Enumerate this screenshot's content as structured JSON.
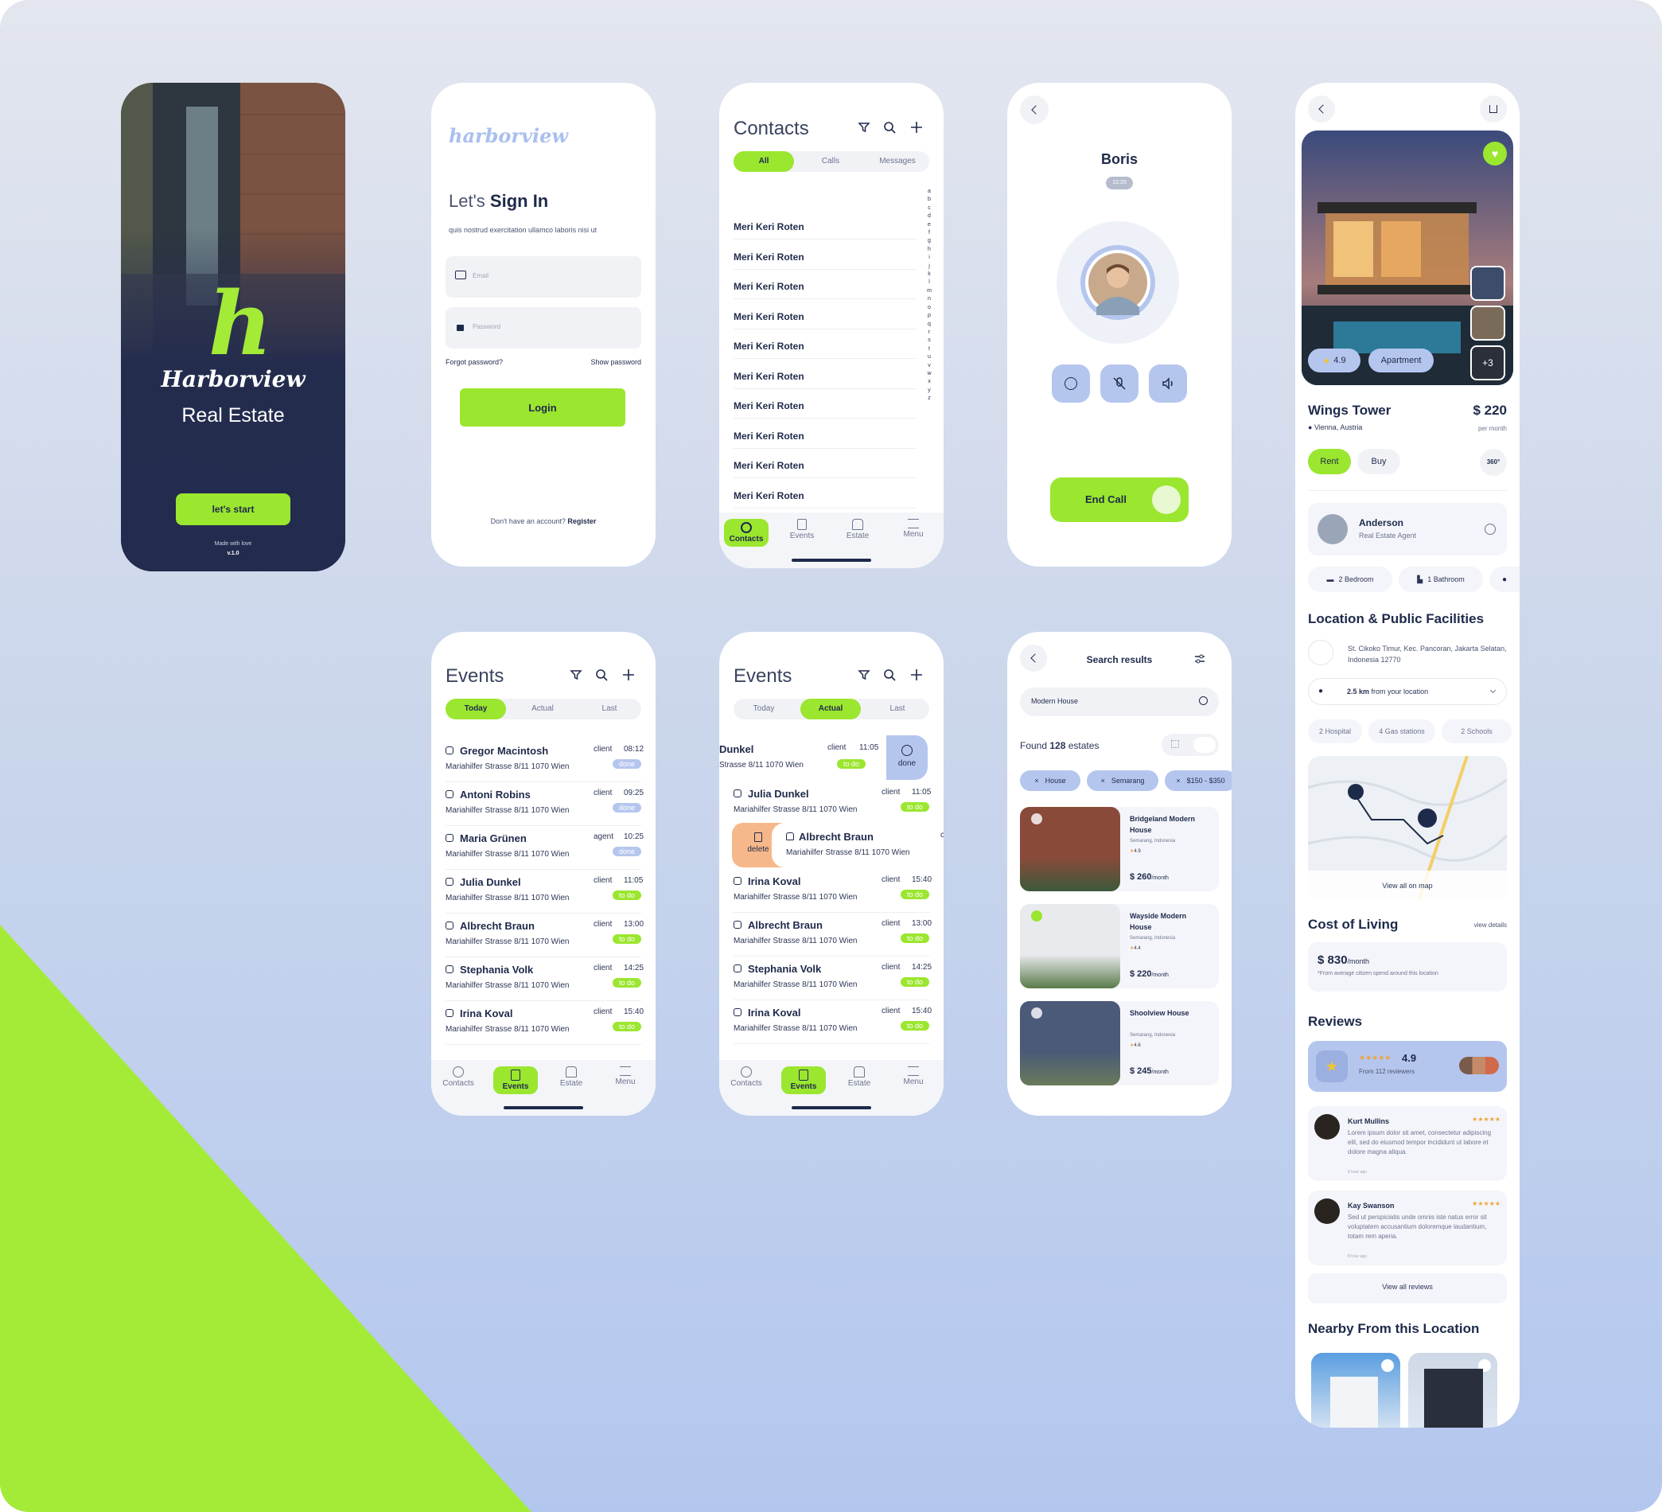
{
  "splash": {
    "brand": "Harborview",
    "subtitle": "Real Estate",
    "cta": "let's start",
    "made": "Made with love",
    "version": "v.1.0"
  },
  "signin": {
    "logo": "harborview",
    "title_light": "Let's",
    "title_bold": "Sign In",
    "subtitle": "quis nostrud exercitation ullamco laboris nisi ut",
    "email_ph": "Email",
    "password_ph": "Password",
    "forgot": "Forgot password?",
    "show": "Show password",
    "login": "Login",
    "no_account": "Don't have an account?",
    "register": "Register"
  },
  "contacts": {
    "title": "Contacts",
    "tabs": [
      "All",
      "Calls",
      "Messages"
    ],
    "items": [
      "Meri Keri Roten",
      "Meri Keri Roten",
      "Meri Keri Roten",
      "Meri Keri Roten",
      "Meri Keri Roten",
      "Meri Keri Roten",
      "Meri Keri Roten",
      "Meri Keri Roten",
      "Meri Keri Roten",
      "Meri Keri Roten",
      "Meri Keri Roten"
    ],
    "alphabet": [
      "a",
      "b",
      "c",
      "d",
      "e",
      "f",
      "g",
      "h",
      "i",
      "j",
      "k",
      "l",
      "m",
      "n",
      "o",
      "p",
      "q",
      "r",
      "s",
      "t",
      "u",
      "v",
      "w",
      "x",
      "y",
      "z"
    ]
  },
  "nav": {
    "contacts": "Contacts",
    "events": "Events",
    "estate": "Estate",
    "menu": "Menu"
  },
  "call": {
    "name": "Boris",
    "duration": "12:25",
    "end": "End Call"
  },
  "events1": {
    "title": "Events",
    "tabs": [
      "Today",
      "Actual",
      "Last"
    ],
    "items": [
      {
        "name": "Gregor Macintosh",
        "role": "client",
        "time": "08:12",
        "addr": "Mariahilfer Strasse 8/11 1070 Wien",
        "status": "done"
      },
      {
        "name": "Antoni Robins",
        "role": "client",
        "time": "09:25",
        "addr": "Mariahilfer Strasse 8/11 1070 Wien",
        "status": "done"
      },
      {
        "name": "Maria Grünen",
        "role": "agent",
        "time": "10:25",
        "addr": "Mariahilfer Strasse 8/11 1070 Wien",
        "status": "done"
      },
      {
        "name": "Julia Dunkel",
        "role": "client",
        "time": "11:05",
        "addr": "Mariahilfer Strasse 8/11 1070 Wien",
        "status": "to do"
      },
      {
        "name": "Albrecht Braun",
        "role": "client",
        "time": "13:00",
        "addr": "Mariahilfer Strasse 8/11 1070 Wien",
        "status": "to do"
      },
      {
        "name": "Stephania Volk",
        "role": "client",
        "time": "14:25",
        "addr": "Mariahilfer Strasse 8/11 1070 Wien",
        "status": "to do"
      },
      {
        "name": "Irina Koval",
        "role": "client",
        "time": "15:40",
        "addr": "Mariahilfer Strasse 8/11 1070 Wien",
        "status": "to do"
      }
    ]
  },
  "events2": {
    "title": "Events",
    "tabs": [
      "Today",
      "Actual",
      "Last"
    ],
    "swiped_right": {
      "name": "Dunkel",
      "role": "client",
      "time": "11:05",
      "addr": "Strasse 8/11 1070 Wien",
      "status": "to do",
      "action": "done"
    },
    "swiped_left": {
      "name": "Albrecht Braun",
      "addr": "Mariahilfer Strasse 8/11 1070 Wien",
      "action": "delete",
      "role": "cl"
    },
    "items": [
      {
        "name": "Julia Dunkel",
        "role": "client",
        "time": "11:05",
        "addr": "Mariahilfer Strasse 8/11 1070 Wien",
        "status": "to do"
      },
      {
        "name": "Irina Koval",
        "role": "client",
        "time": "15:40",
        "addr": "Mariahilfer Strasse 8/11 1070 Wien",
        "status": "to do"
      },
      {
        "name": "Albrecht Braun",
        "role": "client",
        "time": "13:00",
        "addr": "Mariahilfer Strasse 8/11 1070 Wien",
        "status": "to do"
      },
      {
        "name": "Stephania Volk",
        "role": "client",
        "time": "14:25",
        "addr": "Mariahilfer Strasse 8/11 1070 Wien",
        "status": "to do"
      },
      {
        "name": "Irina Koval",
        "role": "client",
        "time": "15:40",
        "addr": "Mariahilfer Strasse 8/11 1070 Wien",
        "status": "to do"
      }
    ]
  },
  "search": {
    "title": "Search results",
    "query": "Modern House",
    "found_pre": "Found",
    "found_count": "128",
    "found_post": "estates",
    "chips": [
      "House",
      "Semarang",
      "$150 - $350"
    ],
    "results": [
      {
        "name": "Bridgeland Modern House",
        "loc": "Semarang, Indonesia",
        "rating": "4.9",
        "price": "$ 260",
        "per": "/month"
      },
      {
        "name": "Wayside Modern House",
        "loc": "Semarang, Indonesia",
        "rating": "4.4",
        "price": "$ 220",
        "per": "/month"
      },
      {
        "name": "Shoolview House",
        "loc": "Semarang, Indonesia",
        "rating": "4.6",
        "price": "$ 245",
        "per": "/month"
      }
    ]
  },
  "detail": {
    "rating": "4.9",
    "type": "Apartment",
    "more": "+3",
    "name": "Wings Tower",
    "location": "Vienna, Austria",
    "price": "$ 220",
    "per": "per month",
    "rent": "Rent",
    "buy": "Buy",
    "agent_name": "Anderson",
    "agent_role": "Real Estate Agent",
    "bedroom": "2 Bedroom",
    "bathroom": "1 Bathroom",
    "loc_title": "Location & Public Facilities",
    "address": "St. Cikoko Timur, Kec. Pancoran, Jakarta Selatan, Indonesia 12770",
    "distance_bold": "2.5 km",
    "distance_rest": "from your location",
    "facilities": [
      "2 Hospital",
      "4 Gas stations",
      "2 Schools"
    ],
    "map_link": "View all on map",
    "col_title": "Cost of Living",
    "col_link": "view details",
    "col_value": "$ 830",
    "col_unit": "/month",
    "col_note": "*From average citizen spend around this location",
    "reviews_title": "Reviews",
    "reviews_score": "4.9",
    "reviews_count": "From 112 reviewers",
    "reviews": [
      {
        "name": "Kurt Mullins",
        "text": "Lorem ipsum dolor sit amet, consectetur adipiscing elit, sed do eiusmod tempor incididunt ut labore et dolore magna aliqua.",
        "ago": "8 hour ago"
      },
      {
        "name": "Kay Swanson",
        "text": "Sed ut perspiciatis unde omnis iste natus error sit voluptatem accusantium doloremque laudantium, totam rem aperia.",
        "ago": "8 hour ago"
      }
    ],
    "all_reviews": "View all reviews",
    "nearby": "Nearby From this Location"
  },
  "colors": {
    "green": "#9be62f",
    "navy": "#1e2a4a",
    "blue": "#b5c6ee"
  }
}
